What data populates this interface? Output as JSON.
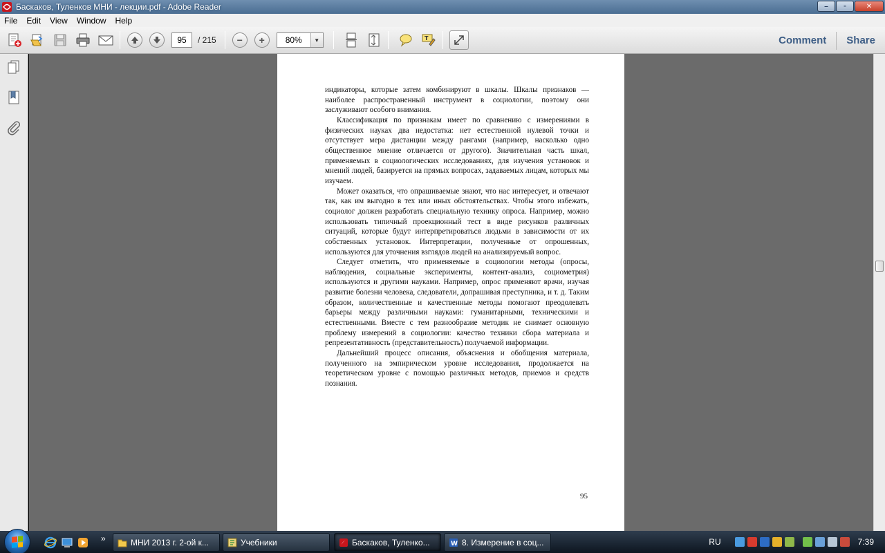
{
  "window": {
    "title": "Баскаков, Туленков МНИ - лекции.pdf - Adobe Reader",
    "minimize_glyph": "–",
    "maximize_glyph": "▫",
    "close_glyph": "✕"
  },
  "menu": {
    "items": [
      "File",
      "Edit",
      "View",
      "Window",
      "Help"
    ]
  },
  "toolbar": {
    "page_current": "95",
    "page_total": "/ 215",
    "zoom": "80%",
    "comment_label": "Comment",
    "share_label": "Share",
    "zoom_out_glyph": "−",
    "zoom_in_glyph": "+",
    "dropdown_glyph": "▼"
  },
  "document": {
    "paragraphs": [
      "индикаторы, которые затем комбинируют в шкалы. Шкалы признаков — наиболее распространенный инструмент в социологии, поэтому они заслуживают особого внимания.",
      "Классификация по признакам имеет по сравнению с измерениями в физических науках два недостатка: нет естественной нулевой точки и отсутствует мера дистанции между рангами (например, насколько одно общественное мнение отличается от другого). Значительная часть шкал, применяемых в социологических исследованиях, для изучения установок и мнений людей, базируется на прямых вопросах, задаваемых лицам, которых мы изучаем.",
      "Может оказаться, что опрашиваемые знают, что нас интересует, и отвечают так, как им выгодно в тех или иных обстоятельствах. Чтобы этого избежать, социолог должен разработать специальную технику опроса. Например, можно использовать типичный проекционный тест в виде рисунков различных ситуаций, которые будут интерпретироваться людьми в зависимости от их собственных установок. Интерпретации, полученные от опрошенных, используются для уточнения взглядов людей на анализируемый вопрос.",
      "Следует отметить, что применяемые в социологии методы (опросы, наблюдения, социальные эксперименты, контент-анализ, социометрия) используются и другими науками. Например, опрос применяют врачи, изучая развитие болезни человека, следователи, допрашивая преступника, и т. д. Таким образом, количественные и качественные методы помогают преодолевать барьеры между различными науками: гуманитарными, техническими и естественными. Вместе с тем разнообразие методик не снимает основную проблему измерений в социологии: качество техники сбора материала и репрезентативность (представительность) получаемой информации.",
      "Дальнейший процесс описания, объяснения и обобщения материала, полученного на эмпирическом уровне исследования, продолжается на теоретическом уровне с помощью различных методов, приемов и средств познания."
    ],
    "page_number": "95"
  },
  "taskbar": {
    "more_glyph": "»",
    "tasks": [
      "МНИ 2013 г. 2-ой к...",
      "Учебники",
      "Баскаков, Туленко...",
      "8. Измерение в соц..."
    ],
    "language": "RU",
    "clock": "7:39"
  },
  "colors": {
    "accent": "#3e5e86",
    "doc_background": "#6b6b6b",
    "pdf_red": "#c8161d"
  }
}
